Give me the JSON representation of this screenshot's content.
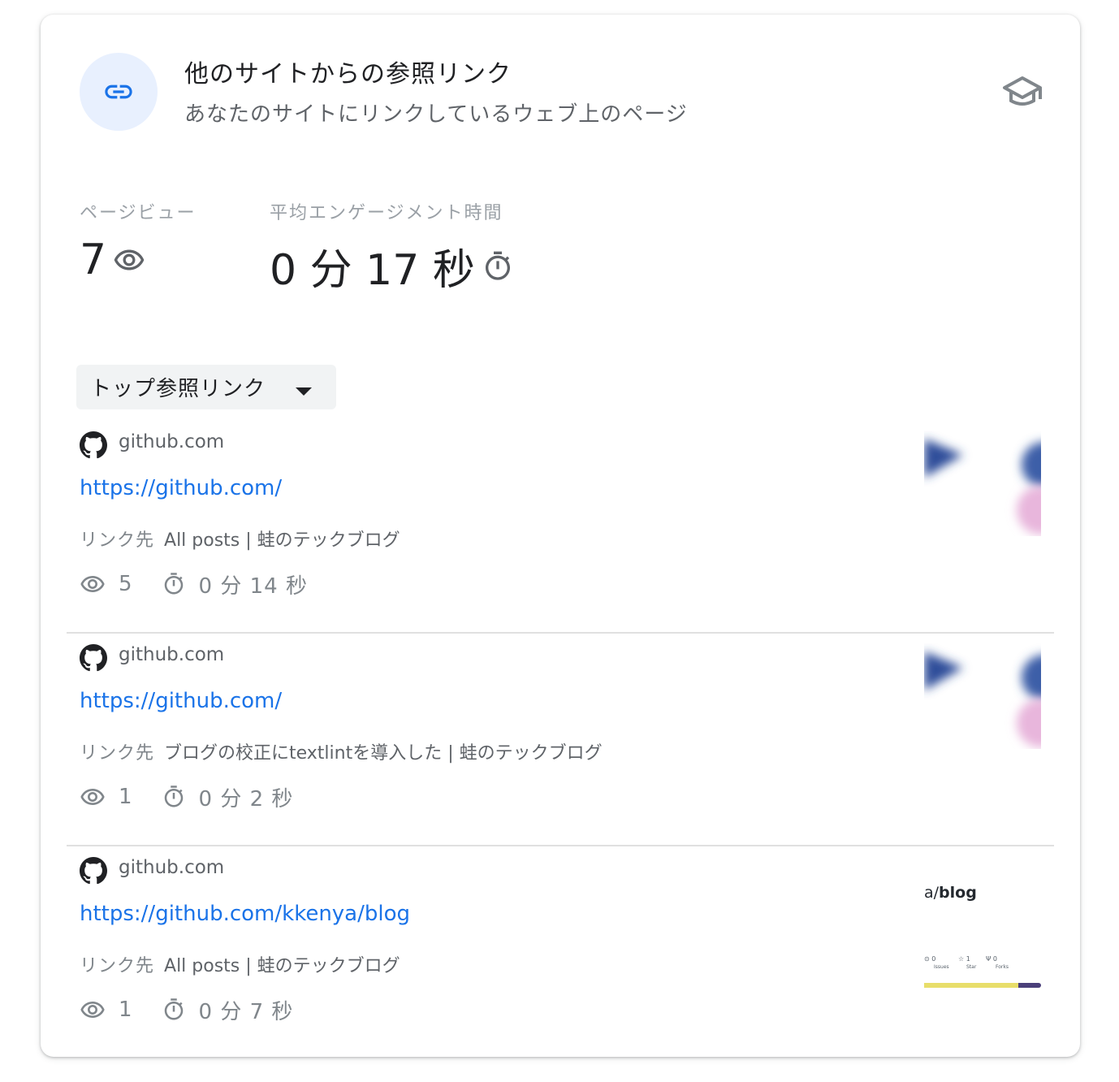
{
  "header": {
    "title": "他のサイトからの参照リンク",
    "subtitle": "あなたのサイトにリンクしているウェブ上のページ",
    "icon": "link-icon",
    "action_icon": "school-icon"
  },
  "stats": {
    "pageviews_label": "ページビュー",
    "pageviews_value": "7",
    "engagement_label": "平均エンゲージメント時間",
    "engagement_value": "0 分 17 秒"
  },
  "dropdown": {
    "label": "トップ参照リンク"
  },
  "referrers": [
    {
      "domain": "github.com",
      "url": "https://github.com/",
      "target_prefix": "リンク先",
      "target_page": "All posts | 蛙のテックブログ",
      "views": "5",
      "time": "0 分 14 秒"
    },
    {
      "domain": "github.com",
      "url": "https://github.com/",
      "target_prefix": "リンク先",
      "target_page": "ブログの校正にtextlintを導入した | 蛙のテックブログ",
      "views": "1",
      "time": "0 分 2 秒"
    },
    {
      "domain": "github.com",
      "url": "https://github.com/kkenya/blog",
      "target_prefix": "リンク先",
      "target_page": "All posts | 蛙のテックブログ",
      "views": "1",
      "time": "0 分 7 秒",
      "thumbnail": {
        "repo_prefix": "a/",
        "repo_name": "blog",
        "issues_count": "0",
        "issues_label": "Issues",
        "star_count": "1",
        "star_label": "Star",
        "forks_count": "0",
        "forks_label": "Forks"
      }
    }
  ],
  "colors": {
    "link": "#1a73e8",
    "icon_bg": "#e8f0fe",
    "muted": "#80868b"
  }
}
